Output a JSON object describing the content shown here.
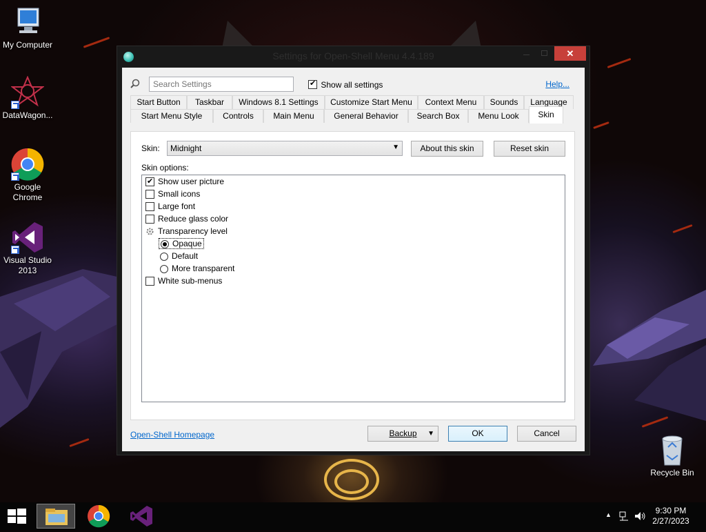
{
  "desktop": {
    "icons": [
      {
        "label": "My Computer",
        "icon": "computer-icon"
      },
      {
        "label": "DataWagon...",
        "icon": "datawagon-icon"
      },
      {
        "label": "Google Chrome",
        "icon": "chrome-icon"
      },
      {
        "label": "Visual Studio 2013",
        "icon": "visual-studio-icon"
      },
      {
        "label": "Recycle Bin",
        "icon": "recycle-bin-icon"
      }
    ]
  },
  "window": {
    "title": "Settings for Open-Shell Menu 4.4.189",
    "close_glyph": "✕",
    "search": {
      "placeholder": "Search Settings"
    },
    "show_all_label": "Show all settings",
    "show_all_checked": true,
    "help_link": "Help...",
    "tabs_row1": [
      "Start Button",
      "Taskbar",
      "Windows 8.1 Settings",
      "Customize Start Menu",
      "Context Menu",
      "Sounds",
      "Language"
    ],
    "tabs_row2": [
      "Start Menu Style",
      "Controls",
      "Main Menu",
      "General Behavior",
      "Search Box",
      "Menu Look",
      "Skin"
    ],
    "active_tab": "Skin",
    "skin_panel": {
      "skin_label": "Skin:",
      "skin_value": "Midnight",
      "about_button": "About this skin",
      "reset_button": "Reset skin",
      "options_label": "Skin options:",
      "options": [
        {
          "label": "Show user picture",
          "type": "checkbox",
          "checked": true
        },
        {
          "label": "Small icons",
          "type": "checkbox",
          "checked": false
        },
        {
          "label": "Large font",
          "type": "checkbox",
          "checked": false
        },
        {
          "label": "Reduce glass color",
          "type": "checkbox",
          "checked": false
        },
        {
          "label": "Transparency level",
          "type": "group"
        },
        {
          "label": "Opaque",
          "type": "radio",
          "checked": true
        },
        {
          "label": "Default",
          "type": "radio",
          "checked": false
        },
        {
          "label": "More transparent",
          "type": "radio",
          "checked": false
        },
        {
          "label": "White sub-menus",
          "type": "checkbox",
          "checked": false
        }
      ]
    },
    "homepage_link": "Open-Shell Homepage",
    "backup_button": "Backup",
    "ok_button": "OK",
    "cancel_button": "Cancel"
  },
  "taskbar": {
    "apps": [
      "file-explorer-icon",
      "chrome-icon",
      "visual-studio-icon"
    ],
    "time": "9:30 PM",
    "date": "2/27/2023"
  },
  "colors": {
    "accent_close": "#c7403a",
    "link": "#0066cc"
  }
}
